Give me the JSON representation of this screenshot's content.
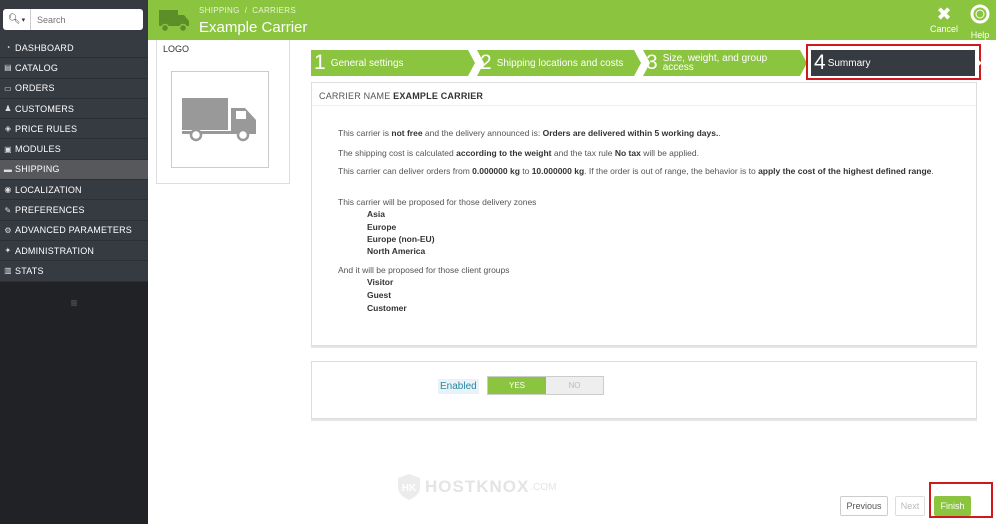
{
  "search": {
    "placeholder": "Search",
    "icon": "search-icon"
  },
  "menu": [
    {
      "label": "DASHBOARD",
      "icon": "dashboard-icon",
      "glyph": "◔"
    },
    {
      "label": "CATALOG",
      "icon": "catalog-icon",
      "glyph": "▤"
    },
    {
      "label": "ORDERS",
      "icon": "orders-icon",
      "glyph": "▭"
    },
    {
      "label": "CUSTOMERS",
      "icon": "customers-icon",
      "glyph": "♟"
    },
    {
      "label": "PRICE RULES",
      "icon": "price-rules-icon",
      "glyph": "◈"
    },
    {
      "label": "MODULES",
      "icon": "modules-icon",
      "glyph": "▣"
    },
    {
      "label": "SHIPPING",
      "icon": "truck-icon",
      "glyph": "▬",
      "active": true
    },
    {
      "label": "LOCALIZATION",
      "icon": "globe-icon",
      "glyph": "◉"
    },
    {
      "label": "PREFERENCES",
      "icon": "wrench-icon",
      "glyph": "✎"
    },
    {
      "label": "ADVANCED PARAMETERS",
      "icon": "cogs-icon",
      "glyph": "⚙"
    },
    {
      "label": "ADMINISTRATION",
      "icon": "cog-icon",
      "glyph": "✦"
    },
    {
      "label": "STATS",
      "icon": "stats-icon",
      "glyph": "▥"
    }
  ],
  "header": {
    "breadcrumb": [
      "SHIPPING",
      "CARRIERS"
    ],
    "breadcrumb_sep": "/",
    "title": "Example Carrier",
    "cancel_label": "Cancel",
    "help_label": "Help"
  },
  "logo_panel": {
    "label": "LOGO"
  },
  "steps": [
    {
      "num": "1",
      "label": "General settings",
      "state": "done"
    },
    {
      "num": "2",
      "label": "Shipping locations and costs",
      "state": "done"
    },
    {
      "num": "3",
      "label": "Size, weight, and group access",
      "state": "done"
    },
    {
      "num": "4",
      "label": "Summary",
      "state": "current"
    }
  ],
  "summary": {
    "heading_prefix": "CARRIER NAME",
    "heading_name": "EXAMPLE CARRIER",
    "l1_a": "This carrier is ",
    "l1_b": "not free",
    "l1_c": " and the delivery announced is: ",
    "l1_d": "Orders are delivered within 5 working days.",
    "l1_e": ".",
    "l2_a": "The shipping cost is calculated ",
    "l2_b": "according to the weight",
    "l2_c": " and the tax rule ",
    "l2_d": "No tax",
    "l2_e": " will be applied.",
    "l3_a": "This carrier can deliver orders from ",
    "l3_b": "0.000000 kg",
    "l3_c": " to ",
    "l3_d": "10.000000 kg",
    "l3_e": ". If the order is out of range, the behavior is to ",
    "l3_f": "apply the cost of the highest defined range",
    "l3_g": ".",
    "zones_intro": "This carrier will be proposed for those delivery zones",
    "zones": [
      "Asia",
      "Europe",
      "Europe (non-EU)",
      "North America"
    ],
    "groups_intro": "And it will be proposed for those client groups",
    "groups": [
      "Visitor",
      "Guest",
      "Customer"
    ]
  },
  "enabled": {
    "label": "Enabled",
    "yes": "YES",
    "no": "NO",
    "value": "YES"
  },
  "watermark": {
    "text": "HOSTKNOX",
    "suffix": ".COM"
  },
  "footer": {
    "previous": "Previous",
    "next": "Next",
    "finish": "Finish"
  },
  "colors": {
    "accent": "#8bc43f",
    "sidebar": "#363a41",
    "highlight": "#d1181f"
  }
}
